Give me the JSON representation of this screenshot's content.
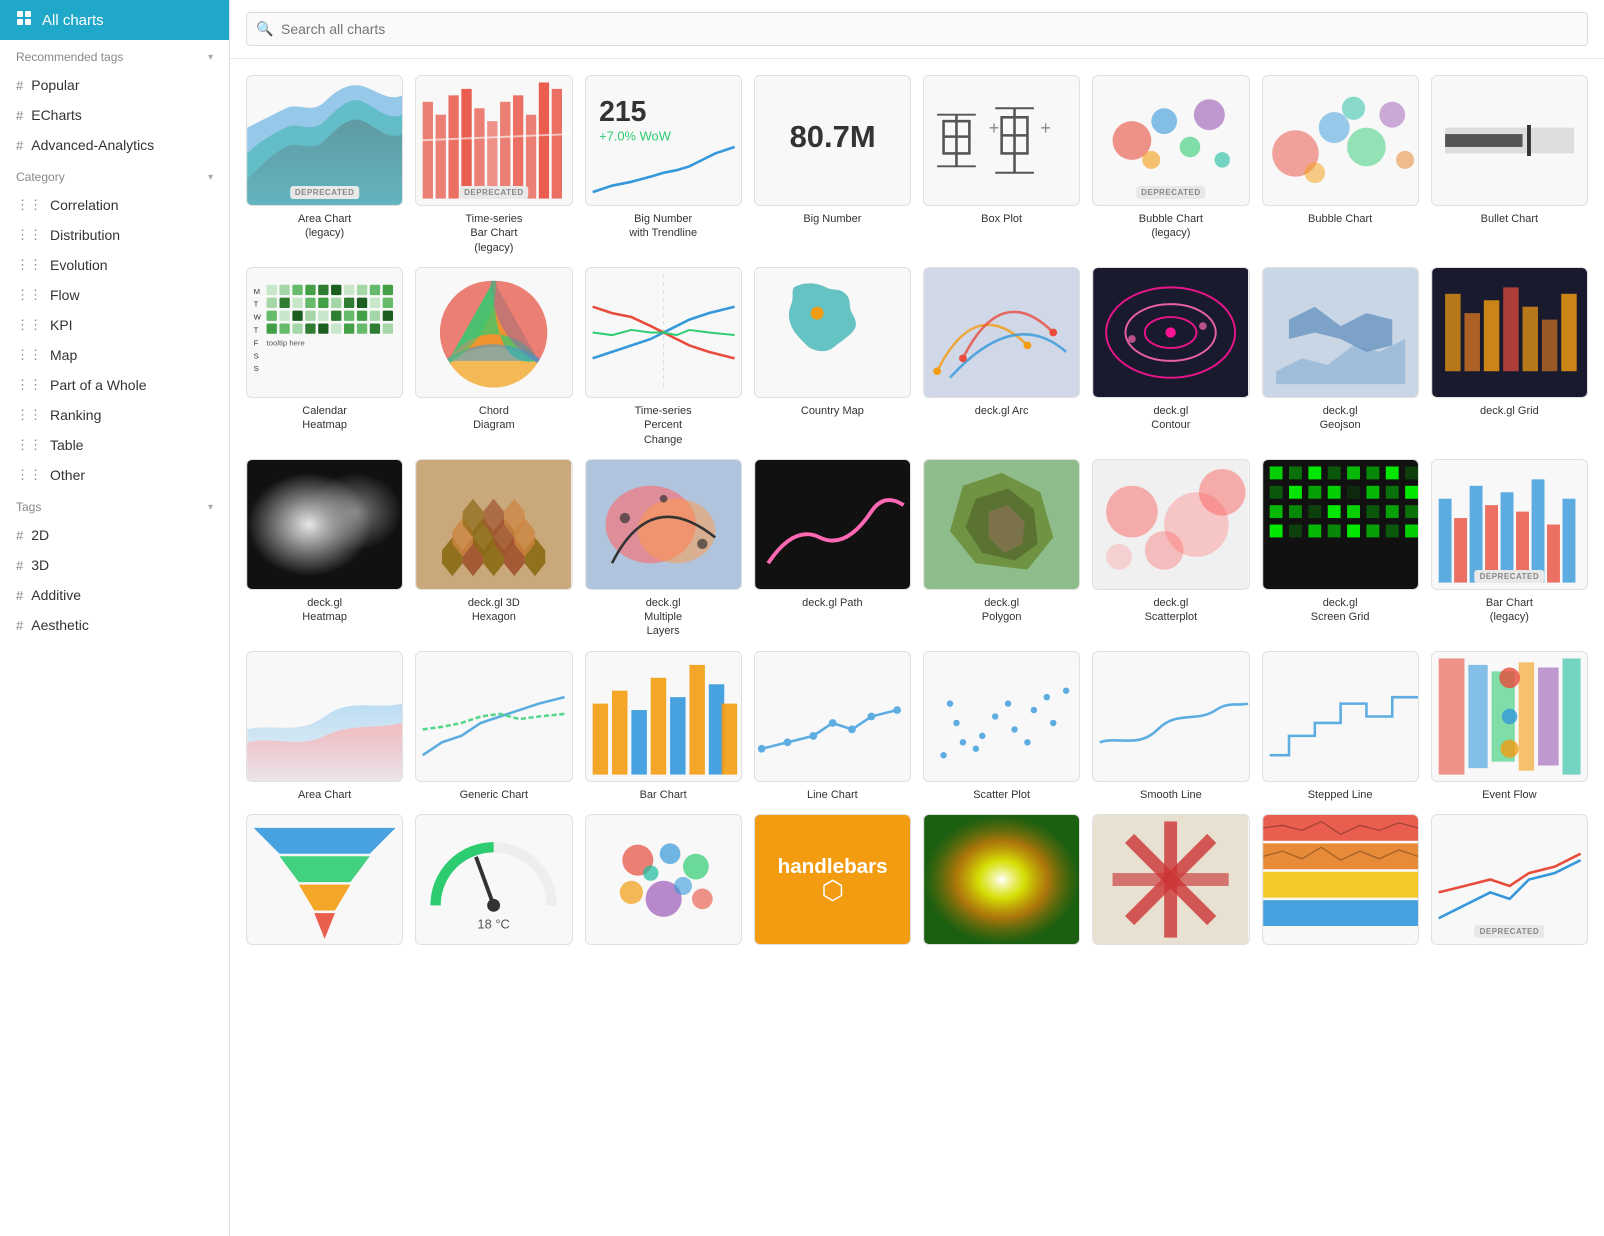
{
  "sidebar": {
    "active_item": {
      "label": "All charts",
      "icon": "grid-icon"
    },
    "sections": [
      {
        "id": "recommended-tags",
        "label": "Recommended tags",
        "items": [
          {
            "id": "popular",
            "label": "Popular",
            "prefix": "#"
          },
          {
            "id": "echarts",
            "label": "ECharts",
            "prefix": "#"
          },
          {
            "id": "advanced-analytics",
            "label": "Advanced-Analytics",
            "prefix": "#"
          }
        ]
      },
      {
        "id": "category",
        "label": "Category",
        "items": [
          {
            "id": "correlation",
            "label": "Correlation",
            "prefix": "cat"
          },
          {
            "id": "distribution",
            "label": "Distribution",
            "prefix": "cat"
          },
          {
            "id": "evolution",
            "label": "Evolution",
            "prefix": "cat"
          },
          {
            "id": "flow",
            "label": "Flow",
            "prefix": "cat"
          },
          {
            "id": "kpi",
            "label": "KPI",
            "prefix": "cat"
          },
          {
            "id": "map",
            "label": "Map",
            "prefix": "cat"
          },
          {
            "id": "part-of-whole",
            "label": "Part of a Whole",
            "prefix": "cat"
          },
          {
            "id": "ranking",
            "label": "Ranking",
            "prefix": "cat"
          },
          {
            "id": "table",
            "label": "Table",
            "prefix": "cat"
          },
          {
            "id": "other",
            "label": "Other",
            "prefix": "cat"
          }
        ]
      },
      {
        "id": "tags",
        "label": "Tags",
        "items": [
          {
            "id": "2d",
            "label": "2D",
            "prefix": "#"
          },
          {
            "id": "3d",
            "label": "3D",
            "prefix": "#"
          },
          {
            "id": "additive",
            "label": "Additive",
            "prefix": "#"
          },
          {
            "id": "aesthetic",
            "label": "Aesthetic",
            "prefix": "#"
          }
        ]
      }
    ]
  },
  "search": {
    "placeholder": "Search all charts"
  },
  "charts": [
    {
      "id": "area-chart-legacy",
      "label": "Area Chart\n(legacy)",
      "deprecated": true,
      "thumb": "area-legacy"
    },
    {
      "id": "timeseries-bar-legacy",
      "label": "Time-series\nBar Chart\n(legacy)",
      "deprecated": true,
      "thumb": "timeseries-bar"
    },
    {
      "id": "big-number-trendline",
      "label": "Big Number\nwith Trendline",
      "deprecated": false,
      "thumb": "big-number-trend"
    },
    {
      "id": "big-number",
      "label": "Big Number",
      "deprecated": false,
      "thumb": "big-number"
    },
    {
      "id": "box-plot",
      "label": "Box Plot",
      "deprecated": false,
      "thumb": "box-plot"
    },
    {
      "id": "bubble-chart-legacy",
      "label": "Bubble Chart\n(legacy)",
      "deprecated": true,
      "thumb": "bubble-legacy"
    },
    {
      "id": "bubble-chart",
      "label": "Bubble Chart",
      "deprecated": false,
      "thumb": "bubble"
    },
    {
      "id": "bullet-chart",
      "label": "Bullet Chart",
      "deprecated": false,
      "thumb": "bullet"
    },
    {
      "id": "calendar-heatmap",
      "label": "Calendar\nHeatmap",
      "deprecated": false,
      "thumb": "calendar-heatmap"
    },
    {
      "id": "chord-diagram",
      "label": "Chord\nDiagram",
      "deprecated": false,
      "thumb": "chord"
    },
    {
      "id": "timeseries-percent",
      "label": "Time-series\nPercent\nChange",
      "deprecated": false,
      "thumb": "timeseries-percent"
    },
    {
      "id": "country-map",
      "label": "Country Map",
      "deprecated": false,
      "thumb": "country-map"
    },
    {
      "id": "deckgl-arc",
      "label": "deck.gl Arc",
      "deprecated": false,
      "thumb": "deckgl-arc"
    },
    {
      "id": "deckgl-contour",
      "label": "deck.gl\nContour",
      "deprecated": false,
      "thumb": "deckgl-contour"
    },
    {
      "id": "deckgl-geojson",
      "label": "deck.gl\nGeojson",
      "deprecated": false,
      "thumb": "deckgl-geojson"
    },
    {
      "id": "deckgl-grid",
      "label": "deck.gl Grid",
      "deprecated": false,
      "thumb": "deckgl-grid"
    },
    {
      "id": "deckgl-heatmap",
      "label": "deck.gl\nHeatmap",
      "deprecated": false,
      "thumb": "deckgl-heatmap"
    },
    {
      "id": "deckgl-3d-hexagon",
      "label": "deck.gl 3D\nHexagon",
      "deprecated": false,
      "thumb": "deckgl-hexagon"
    },
    {
      "id": "deckgl-multiple-layers",
      "label": "deck.gl\nMultiple\nLayers",
      "deprecated": false,
      "thumb": "deckgl-multiple"
    },
    {
      "id": "deckgl-path",
      "label": "deck.gl Path",
      "deprecated": false,
      "thumb": "deckgl-path"
    },
    {
      "id": "deckgl-polygon",
      "label": "deck.gl\nPolygon",
      "deprecated": false,
      "thumb": "deckgl-polygon"
    },
    {
      "id": "deckgl-scatterplot",
      "label": "deck.gl\nScatterplot",
      "deprecated": false,
      "thumb": "deckgl-scatter"
    },
    {
      "id": "deckgl-screen-grid",
      "label": "deck.gl\nScreen Grid",
      "deprecated": false,
      "thumb": "deckgl-screen-grid"
    },
    {
      "id": "bar-chart-legacy",
      "label": "Bar Chart\n(legacy)",
      "deprecated": true,
      "thumb": "bar-legacy"
    },
    {
      "id": "area-chart",
      "label": "Area Chart",
      "deprecated": false,
      "thumb": "area"
    },
    {
      "id": "generic-chart",
      "label": "Generic Chart",
      "deprecated": false,
      "thumb": "generic"
    },
    {
      "id": "bar-chart",
      "label": "Bar Chart",
      "deprecated": false,
      "thumb": "bar"
    },
    {
      "id": "line-chart",
      "label": "Line Chart",
      "deprecated": false,
      "thumb": "line"
    },
    {
      "id": "scatter-plot",
      "label": "Scatter Plot",
      "deprecated": false,
      "thumb": "scatter"
    },
    {
      "id": "smooth-line",
      "label": "Smooth Line",
      "deprecated": false,
      "thumb": "smooth-line"
    },
    {
      "id": "stepped-line",
      "label": "Stepped Line",
      "deprecated": false,
      "thumb": "stepped-line"
    },
    {
      "id": "event-flow",
      "label": "Event Flow",
      "deprecated": false,
      "thumb": "event-flow"
    },
    {
      "id": "funnel",
      "label": "",
      "deprecated": false,
      "thumb": "funnel"
    },
    {
      "id": "gauge",
      "label": "",
      "deprecated": false,
      "thumb": "gauge"
    },
    {
      "id": "word-cloud",
      "label": "",
      "deprecated": false,
      "thumb": "word-cloud"
    },
    {
      "id": "handlebars",
      "label": "",
      "deprecated": false,
      "thumb": "handlebars"
    },
    {
      "id": "heatmap",
      "label": "",
      "deprecated": false,
      "thumb": "heatmap"
    },
    {
      "id": "rose",
      "label": "",
      "deprecated": false,
      "thumb": "rose"
    },
    {
      "id": "horizon",
      "label": "",
      "deprecated": false,
      "thumb": "horizon"
    },
    {
      "id": "last-card",
      "label": "",
      "deprecated": true,
      "thumb": "last-card"
    }
  ]
}
